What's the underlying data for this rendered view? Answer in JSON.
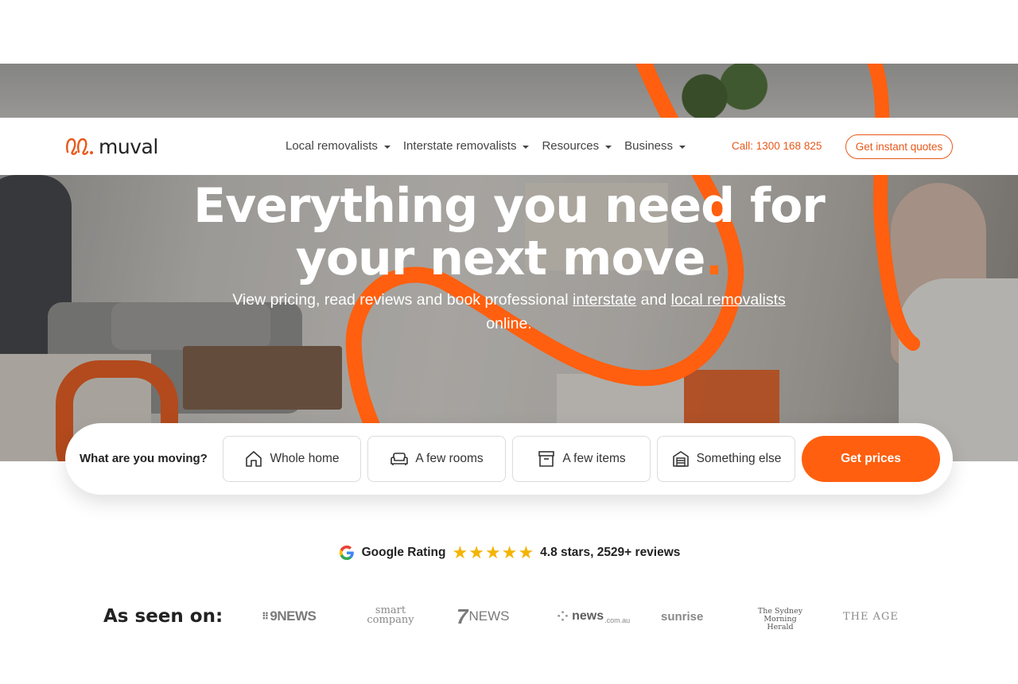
{
  "brand": {
    "name": "muval",
    "accent": "#e8581a",
    "cta": "#ff5f0f"
  },
  "nav": {
    "items": [
      {
        "label": "Local removalists"
      },
      {
        "label": "Interstate removalists"
      },
      {
        "label": "Resources"
      },
      {
        "label": "Business"
      }
    ],
    "call": "Call: 1300 168 825",
    "cta": "Get instant quotes"
  },
  "hero": {
    "headline_line1": "Everything you need for",
    "headline_line2": "your next move",
    "headline_dot": ".",
    "sub_before": "View pricing, read reviews and book professional ",
    "sub_link1": "interstate",
    "sub_mid": " and ",
    "sub_link2": "local removalists",
    "sub_after": "online."
  },
  "search": {
    "label": "What are you moving?",
    "options": [
      {
        "label": "Whole home",
        "icon": "home-icon"
      },
      {
        "label": "A few rooms",
        "icon": "sofa-icon"
      },
      {
        "label": "A few items",
        "icon": "box-icon"
      },
      {
        "label": "Something else",
        "icon": "building-icon"
      }
    ],
    "submit": "Get prices"
  },
  "rating": {
    "label": "Google Rating",
    "stars": 5,
    "text": "4.8 stars, 2529+ reviews"
  },
  "press": {
    "label": "As seen on:",
    "logos": {
      "ninenews": "9NEWS",
      "smart_top": "smart",
      "smart_bottom": "company",
      "sevennews": "NEWS",
      "newscom": "news",
      "newscom_sub": ".com.au",
      "sunrise": "sunrise",
      "smh_line1": "The Sydney",
      "smh_line2": "Morning Herald",
      "age": "THE AGE"
    }
  }
}
